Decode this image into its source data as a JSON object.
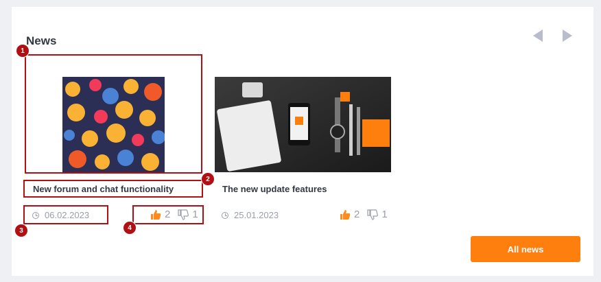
{
  "section": {
    "title": "News"
  },
  "news": [
    {
      "title": "New forum and chat functionality",
      "date": "06.02.2023",
      "likes": "2",
      "dislikes": "1"
    },
    {
      "title": "The new update features",
      "date": "25.01.2023",
      "likes": "2",
      "dislikes": "1"
    }
  ],
  "annotations": [
    "1",
    "2",
    "3",
    "4"
  ],
  "footer": {
    "all_news_label": "All news"
  },
  "colors": {
    "accent": "#ff7f0e",
    "annotation": "#b10f12",
    "muted": "#9a9ea8"
  }
}
